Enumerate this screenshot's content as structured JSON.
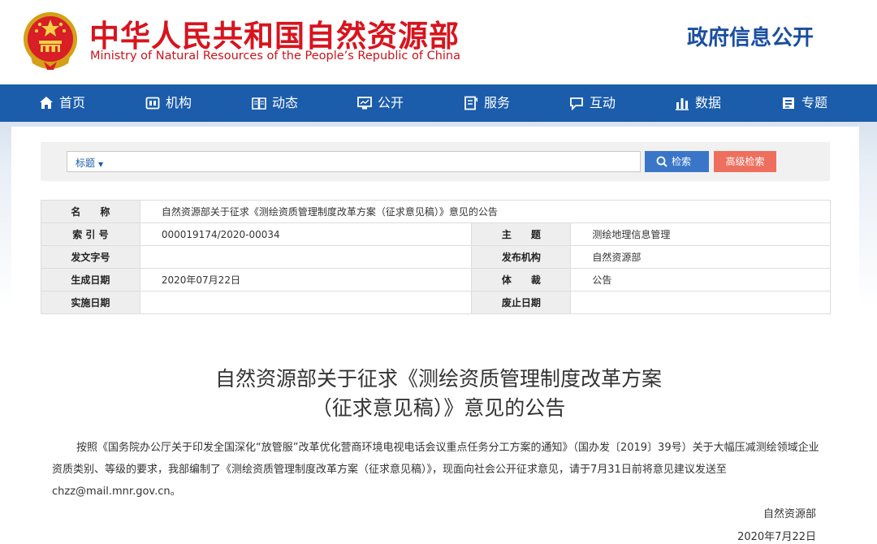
{
  "header": {
    "title_cn": "中华人民共和国自然资源部",
    "title_en": "Ministry of Natural Resources of the People’s Republic of China",
    "gov_open": "政府信息公开",
    "colors": {
      "brand_red": "#d8141e",
      "brand_blue": "#1b5cab"
    }
  },
  "nav": {
    "items": [
      {
        "label": "首页",
        "icon": "home-icon"
      },
      {
        "label": "机构",
        "icon": "org-icon"
      },
      {
        "label": "动态",
        "icon": "news-icon"
      },
      {
        "label": "公开",
        "icon": "monitor-icon"
      },
      {
        "label": "服务",
        "icon": "service-icon"
      },
      {
        "label": "互动",
        "icon": "chat-icon"
      },
      {
        "label": "数据",
        "icon": "chart-icon"
      },
      {
        "label": "专题",
        "icon": "topic-icon"
      }
    ]
  },
  "search": {
    "field_select": "标题",
    "query": "",
    "search_label": "检索",
    "advanced_label": "高级检索"
  },
  "info": {
    "name_label": "名　　称",
    "name_value": "自然资源部关于征求《测绘资质管理制度改革方案（征求意见稿）》意见的公告",
    "index_label": "索 引 号",
    "index_value": "000019174/2020-00034",
    "topic_label": "主　　题",
    "topic_value": "测绘地理信息管理",
    "docno_label": "发文字号",
    "docno_value": "",
    "publisher_label": "发布机构",
    "publisher_value": "自然资源部",
    "created_label": "生成日期",
    "created_value": "2020年07月22日",
    "genre_label": "体　　裁",
    "genre_value": "公告",
    "effective_label": "实施日期",
    "effective_value": "",
    "expire_label": "废止日期",
    "expire_value": ""
  },
  "article": {
    "title_line1": "自然资源部关于征求《测绘资质管理制度改革方案",
    "title_line2": "（征求意见稿）》意见的公告",
    "body": "按照《国务院办公厅关于印发全国深化“放管服”改革优化营商环境电视电话会议重点任务分工方案的通知》（国办发〔2019〕39号）关于大幅压减测绘领域企业资质类别、等级的要求，我部编制了《测绘资质管理制度改革方案（征求意见稿）》，现面向社会公开征求意见，请于7月31日前将意见建议发送至chzz@mail.mnr.gov.cn。",
    "signature": "自然资源部",
    "date": "2020年7月22日"
  }
}
